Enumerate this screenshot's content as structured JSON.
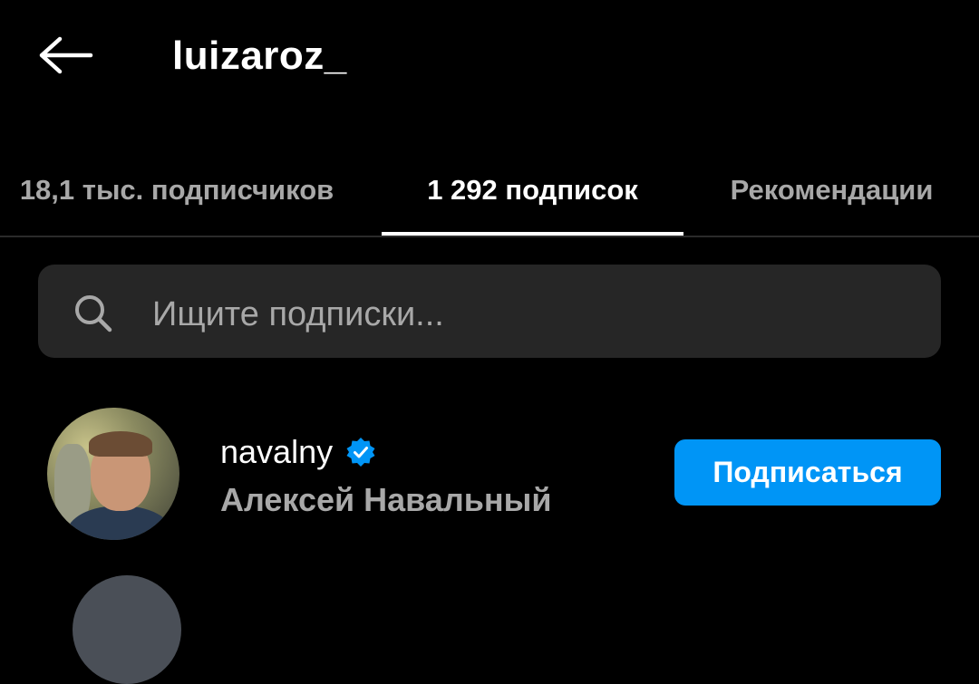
{
  "header": {
    "back_icon": "arrow-left-icon",
    "username": "luizaroz_"
  },
  "tabs": [
    {
      "label": "18,1 тыс. подписчиков",
      "active": false
    },
    {
      "label": "1 292 подписок",
      "active": true
    },
    {
      "label": "Рекомендации",
      "active": false
    }
  ],
  "search": {
    "icon": "search-icon",
    "placeholder": "Ищите подписки..."
  },
  "accounts": [
    {
      "username": "navalny",
      "verified": true,
      "full_name": "Алексей Навальный",
      "button_label": "Подписаться"
    }
  ],
  "colors": {
    "background": "#000000",
    "search_bg": "#262626",
    "secondary_text": "#a8a8a8",
    "accent": "#0095f6",
    "verified_badge": "#0095f6"
  }
}
